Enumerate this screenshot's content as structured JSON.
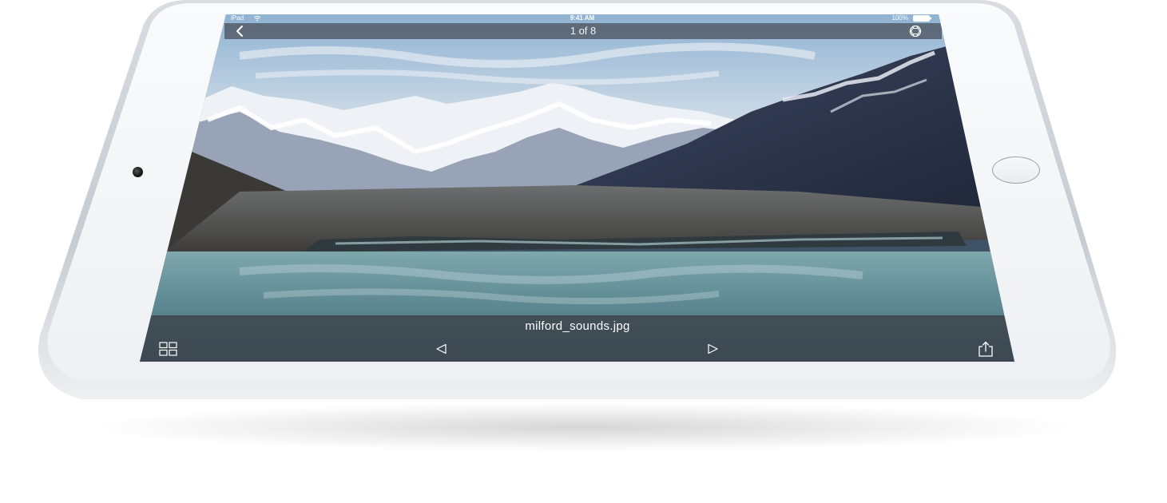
{
  "status_bar": {
    "device_label": "iPad",
    "wifi_icon": "wifi-icon",
    "time": "9:41 AM",
    "battery_percent": "100%",
    "battery_icon": "battery-icon"
  },
  "nav_bar": {
    "back_icon": "chevron-left-icon",
    "page_counter": "1 of 8",
    "settings_icon": "aperture-icon"
  },
  "viewer": {
    "filename": "milford_sounds.jpg",
    "photo_subject": "snow-capped mountains above a glacial lake"
  },
  "toolbar": {
    "grid_icon": "grid-icon",
    "prev_icon": "triangle-left-icon",
    "next_icon": "triangle-right-icon",
    "share_icon": "share-icon"
  },
  "colors": {
    "bar_background": "#464c56",
    "bar_text": "#ffffff",
    "device_body": "#f2f3f5",
    "device_edge": "#c9ced4"
  }
}
